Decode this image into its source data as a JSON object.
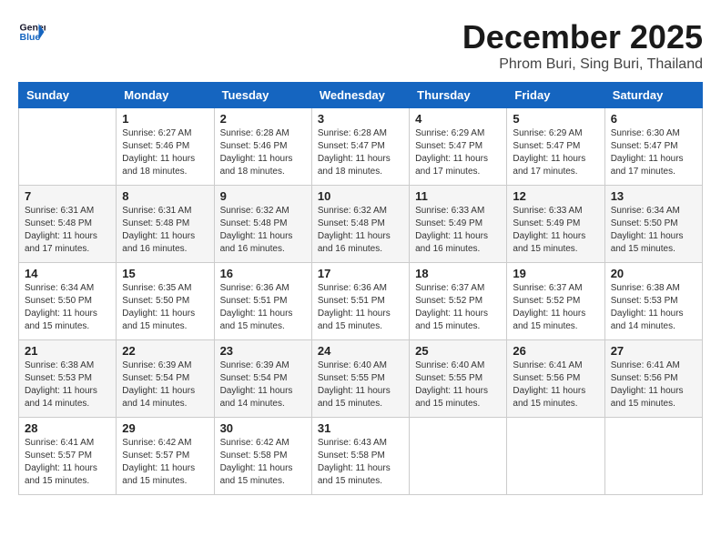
{
  "logo": {
    "line1": "General",
    "line2": "Blue"
  },
  "title": "December 2025",
  "subtitle": "Phrom Buri, Sing Buri, Thailand",
  "weekdays": [
    "Sunday",
    "Monday",
    "Tuesday",
    "Wednesday",
    "Thursday",
    "Friday",
    "Saturday"
  ],
  "weeks": [
    [
      {
        "day": "",
        "info": ""
      },
      {
        "day": "1",
        "info": "Sunrise: 6:27 AM\nSunset: 5:46 PM\nDaylight: 11 hours\nand 18 minutes."
      },
      {
        "day": "2",
        "info": "Sunrise: 6:28 AM\nSunset: 5:46 PM\nDaylight: 11 hours\nand 18 minutes."
      },
      {
        "day": "3",
        "info": "Sunrise: 6:28 AM\nSunset: 5:47 PM\nDaylight: 11 hours\nand 18 minutes."
      },
      {
        "day": "4",
        "info": "Sunrise: 6:29 AM\nSunset: 5:47 PM\nDaylight: 11 hours\nand 17 minutes."
      },
      {
        "day": "5",
        "info": "Sunrise: 6:29 AM\nSunset: 5:47 PM\nDaylight: 11 hours\nand 17 minutes."
      },
      {
        "day": "6",
        "info": "Sunrise: 6:30 AM\nSunset: 5:47 PM\nDaylight: 11 hours\nand 17 minutes."
      }
    ],
    [
      {
        "day": "7",
        "info": "Sunrise: 6:31 AM\nSunset: 5:48 PM\nDaylight: 11 hours\nand 17 minutes."
      },
      {
        "day": "8",
        "info": "Sunrise: 6:31 AM\nSunset: 5:48 PM\nDaylight: 11 hours\nand 16 minutes."
      },
      {
        "day": "9",
        "info": "Sunrise: 6:32 AM\nSunset: 5:48 PM\nDaylight: 11 hours\nand 16 minutes."
      },
      {
        "day": "10",
        "info": "Sunrise: 6:32 AM\nSunset: 5:48 PM\nDaylight: 11 hours\nand 16 minutes."
      },
      {
        "day": "11",
        "info": "Sunrise: 6:33 AM\nSunset: 5:49 PM\nDaylight: 11 hours\nand 16 minutes."
      },
      {
        "day": "12",
        "info": "Sunrise: 6:33 AM\nSunset: 5:49 PM\nDaylight: 11 hours\nand 15 minutes."
      },
      {
        "day": "13",
        "info": "Sunrise: 6:34 AM\nSunset: 5:50 PM\nDaylight: 11 hours\nand 15 minutes."
      }
    ],
    [
      {
        "day": "14",
        "info": "Sunrise: 6:34 AM\nSunset: 5:50 PM\nDaylight: 11 hours\nand 15 minutes."
      },
      {
        "day": "15",
        "info": "Sunrise: 6:35 AM\nSunset: 5:50 PM\nDaylight: 11 hours\nand 15 minutes."
      },
      {
        "day": "16",
        "info": "Sunrise: 6:36 AM\nSunset: 5:51 PM\nDaylight: 11 hours\nand 15 minutes."
      },
      {
        "day": "17",
        "info": "Sunrise: 6:36 AM\nSunset: 5:51 PM\nDaylight: 11 hours\nand 15 minutes."
      },
      {
        "day": "18",
        "info": "Sunrise: 6:37 AM\nSunset: 5:52 PM\nDaylight: 11 hours\nand 15 minutes."
      },
      {
        "day": "19",
        "info": "Sunrise: 6:37 AM\nSunset: 5:52 PM\nDaylight: 11 hours\nand 15 minutes."
      },
      {
        "day": "20",
        "info": "Sunrise: 6:38 AM\nSunset: 5:53 PM\nDaylight: 11 hours\nand 14 minutes."
      }
    ],
    [
      {
        "day": "21",
        "info": "Sunrise: 6:38 AM\nSunset: 5:53 PM\nDaylight: 11 hours\nand 14 minutes."
      },
      {
        "day": "22",
        "info": "Sunrise: 6:39 AM\nSunset: 5:54 PM\nDaylight: 11 hours\nand 14 minutes."
      },
      {
        "day": "23",
        "info": "Sunrise: 6:39 AM\nSunset: 5:54 PM\nDaylight: 11 hours\nand 14 minutes."
      },
      {
        "day": "24",
        "info": "Sunrise: 6:40 AM\nSunset: 5:55 PM\nDaylight: 11 hours\nand 15 minutes."
      },
      {
        "day": "25",
        "info": "Sunrise: 6:40 AM\nSunset: 5:55 PM\nDaylight: 11 hours\nand 15 minutes."
      },
      {
        "day": "26",
        "info": "Sunrise: 6:41 AM\nSunset: 5:56 PM\nDaylight: 11 hours\nand 15 minutes."
      },
      {
        "day": "27",
        "info": "Sunrise: 6:41 AM\nSunset: 5:56 PM\nDaylight: 11 hours\nand 15 minutes."
      }
    ],
    [
      {
        "day": "28",
        "info": "Sunrise: 6:41 AM\nSunset: 5:57 PM\nDaylight: 11 hours\nand 15 minutes."
      },
      {
        "day": "29",
        "info": "Sunrise: 6:42 AM\nSunset: 5:57 PM\nDaylight: 11 hours\nand 15 minutes."
      },
      {
        "day": "30",
        "info": "Sunrise: 6:42 AM\nSunset: 5:58 PM\nDaylight: 11 hours\nand 15 minutes."
      },
      {
        "day": "31",
        "info": "Sunrise: 6:43 AM\nSunset: 5:58 PM\nDaylight: 11 hours\nand 15 minutes."
      },
      {
        "day": "",
        "info": ""
      },
      {
        "day": "",
        "info": ""
      },
      {
        "day": "",
        "info": ""
      }
    ]
  ]
}
